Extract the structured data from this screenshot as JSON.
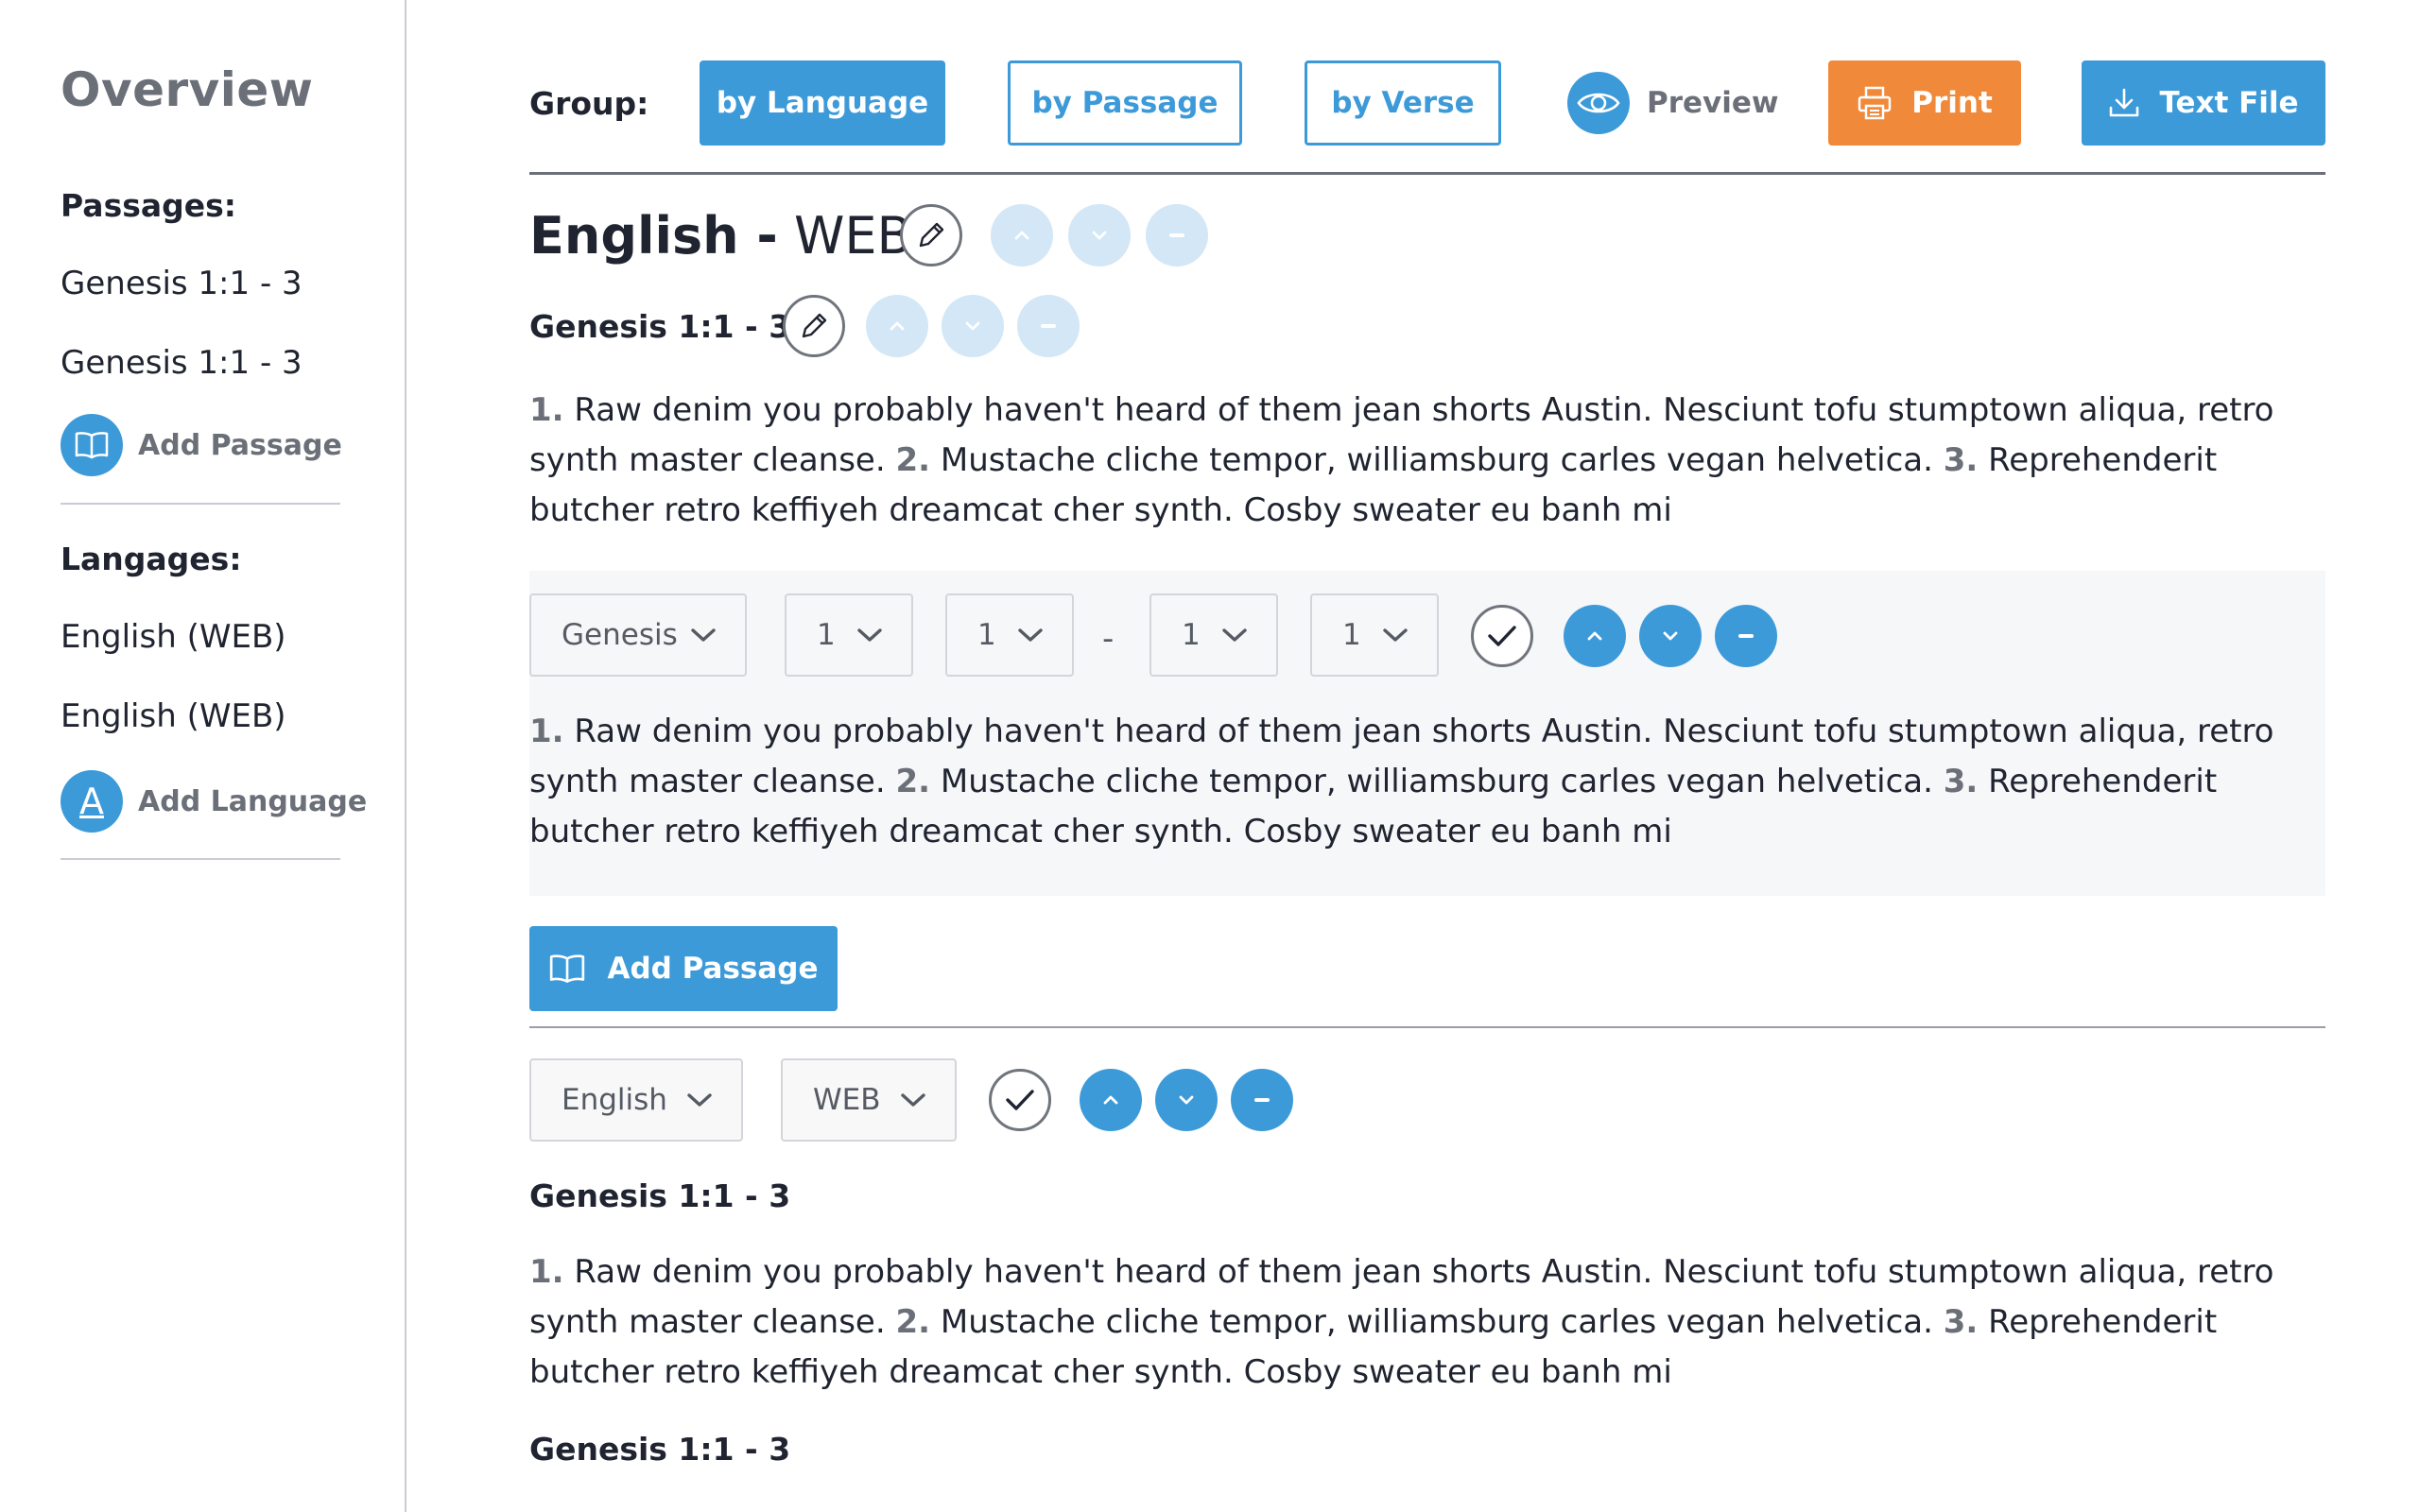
{
  "sidebar": {
    "title": "Overview",
    "passages_heading": "Passages:",
    "passages": [
      "Genesis 1:1 - 3",
      "Genesis 1:1 - 3"
    ],
    "add_passage_label": "Add Passage",
    "languages_heading": "Langages:",
    "languages": [
      "English (WEB)",
      "English (WEB)"
    ],
    "add_language_label": "Add Language",
    "add_language_icon_letter": "A"
  },
  "toolbar": {
    "group_label": "Group:",
    "by_language": "by Language",
    "by_passage": "by Passage",
    "by_verse": "by Verse",
    "preview": "Preview",
    "print": "Print",
    "text_file": "Text File"
  },
  "section1": {
    "language_bold": "English -",
    "version": "WEB",
    "passage_title": "Genesis 1:1 - 3",
    "verse1_num": "1.",
    "verse1": "Raw denim you probably haven't heard of them jean shorts Austin. Nesciunt tofu stumptown aliqua, retro synth master cleanse.",
    "verse2_num": "2.",
    "verse2": "Mustache cliche tempor, williamsburg carles vegan helvetica.",
    "verse3_num": "3.",
    "verse3": "Reprehenderit butcher retro keffiyeh dreamcat cher synth. Cosby sweater eu banh mi"
  },
  "passage_editor": {
    "book": "Genesis",
    "chapter_start": "1",
    "verse_start": "1",
    "range_dash": "-",
    "chapter_end": "1",
    "verse_end": "1",
    "verse1_num": "1.",
    "verse1": "Raw denim you probably haven't heard of them jean shorts Austin. Nesciunt tofu stumptown aliqua, retro synth master cleanse.",
    "verse2_num": "2.",
    "verse2": "Mustache cliche tempor, williamsburg carles vegan helvetica.",
    "verse3_num": "3.",
    "verse3": "Reprehenderit butcher retro keffiyeh dreamcat cher synth. Cosby sweater eu banh mi"
  },
  "add_passage_button": "Add Passage",
  "language_editor": {
    "language": "English",
    "version": "WEB"
  },
  "section2": {
    "passage_title": "Genesis 1:1 - 3",
    "verse1_num": "1.",
    "verse1": "Raw denim you probably haven't heard of them jean shorts Austin. Nesciunt tofu stumptown aliqua, retro synth master cleanse.",
    "verse2_num": "2.",
    "verse2": "Mustache cliche tempor, williamsburg carles vegan helvetica.",
    "verse3_num": "3.",
    "verse3": "Reprehenderit butcher retro keffiyeh dreamcat cher synth. Cosby sweater eu banh mi",
    "next_passage_title": "Genesis 1:1 - 3"
  },
  "colors": {
    "accent_blue": "#3d9ad9",
    "print_orange": "#f0893a",
    "faded_blue": "#d3e7f6",
    "muted_gray": "#6b6f78"
  }
}
